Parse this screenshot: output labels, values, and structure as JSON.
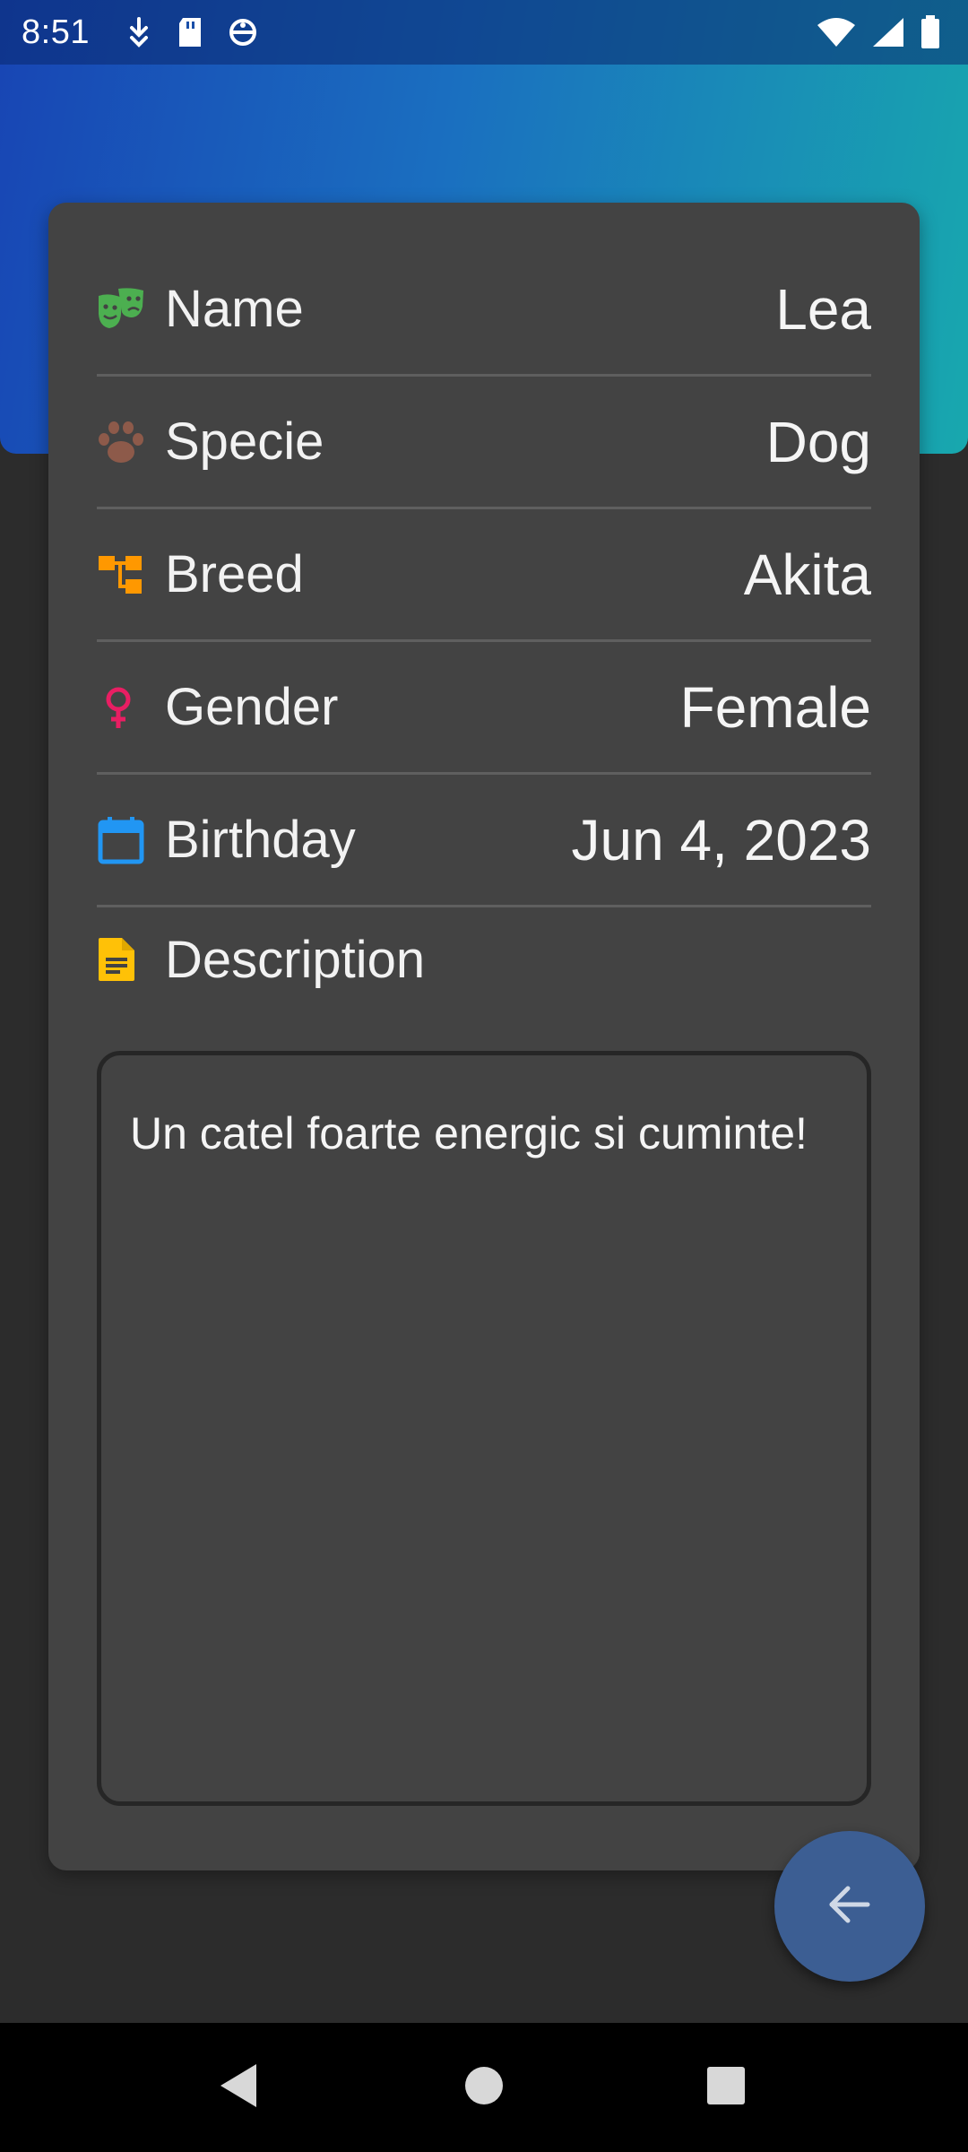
{
  "status_bar": {
    "time": "8:51",
    "left_icons": [
      "download-icon",
      "sd-card-icon",
      "accessibility-icon"
    ],
    "right_icons": [
      "wifi-icon",
      "signal-icon",
      "battery-icon"
    ]
  },
  "pet_details": {
    "rows": [
      {
        "icon": "masks-icon",
        "icon_color": "#4caf50",
        "label": "Name",
        "value": "Lea"
      },
      {
        "icon": "paw-icon",
        "icon_color": "#8d5a4a",
        "label": "Specie",
        "value": "Dog"
      },
      {
        "icon": "breed-tree-icon",
        "icon_color": "#ff9800",
        "label": "Breed",
        "value": "Akita"
      },
      {
        "icon": "female-icon",
        "icon_color": "#e91e63",
        "label": "Gender",
        "value": "Female"
      },
      {
        "icon": "calendar-icon",
        "icon_color": "#2196f3",
        "label": "Birthday",
        "value": "Jun 4, 2023"
      }
    ],
    "description": {
      "icon": "document-icon",
      "icon_color": "#ffc107",
      "label": "Description",
      "text": "Un catel foarte energic si cuminte!"
    }
  },
  "fab": {
    "icon": "arrow-back-icon"
  },
  "nav_bar": {
    "buttons": [
      "back-triangle-icon",
      "home-circle-icon",
      "recents-square-icon"
    ]
  },
  "colors": {
    "header_gradient_start": "#1845b4",
    "header_gradient_end": "#18a8ae",
    "card_background": "#434343",
    "page_background": "#2c2c2c",
    "fab_background": "#3c5e93"
  }
}
